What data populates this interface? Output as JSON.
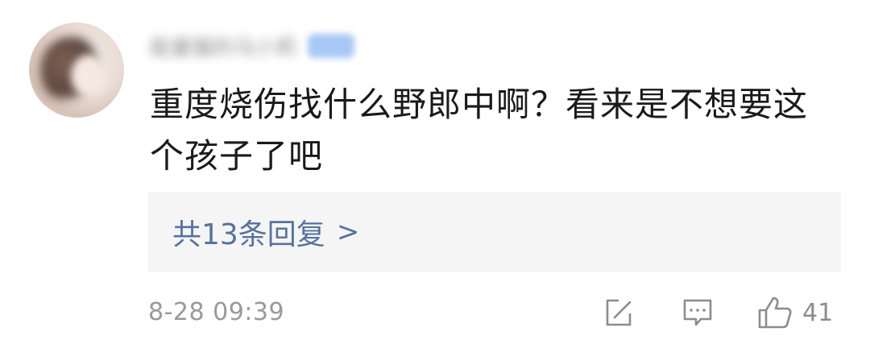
{
  "comment": {
    "username": "能量猫的马小莉",
    "text": "重度烧伤找什么野郎中啊？看来是不想要这个孩子了吧",
    "replies_label": "共13条回复",
    "replies_chevron": ">",
    "timestamp": "8-28 09:39",
    "like_count": "41"
  },
  "icons": {
    "edit": "edit-square-icon",
    "reply": "comment-bubble-icon",
    "like": "thumbs-up-icon",
    "chevron": "chevron-right-icon"
  },
  "colors": {
    "link": "#56739e",
    "meta_text": "#999999",
    "reply_box_bg": "#f5f5f5",
    "main_text": "#1a1a1a"
  }
}
